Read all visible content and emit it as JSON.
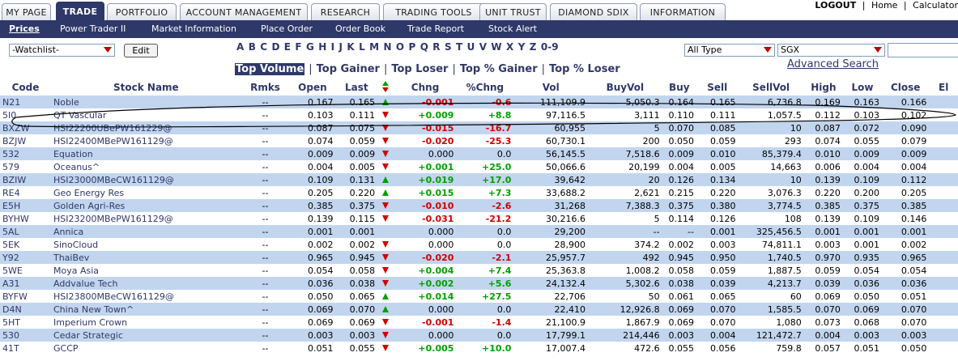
{
  "tabs": [
    {
      "label": "MY PAGE",
      "active": false
    },
    {
      "label": "TRADE",
      "active": true
    },
    {
      "label": "PORTFOLIO",
      "active": false
    },
    {
      "label": "ACCOUNT MANAGEMENT",
      "active": false
    },
    {
      "label": "RESEARCH",
      "active": false
    },
    {
      "label": "TRADING TOOLS",
      "active": false
    },
    {
      "label": "UNIT TRUST",
      "active": false
    },
    {
      "label": "DIAMOND SDIX",
      "active": false
    },
    {
      "label": "INFORMATION",
      "active": false
    }
  ],
  "top_links": {
    "logout": "LOGOUT",
    "home": "Home",
    "calculator": "Calculator",
    "sep": "|"
  },
  "subnav": [
    {
      "label": "Prices",
      "active": true
    },
    {
      "label": "Power Trader II",
      "active": false
    },
    {
      "label": "Market Information",
      "active": false
    },
    {
      "label": "Place Order",
      "active": false
    },
    {
      "label": "Order Book",
      "active": false
    },
    {
      "label": "Trade Report",
      "active": false
    },
    {
      "label": "Stock Alert",
      "active": false
    }
  ],
  "watchlist": {
    "value": "-Watchlist-"
  },
  "edit_label": "Edit",
  "alphabet": [
    "A",
    "B",
    "C",
    "D",
    "E",
    "F",
    "G",
    "H",
    "I",
    "J",
    "K",
    "L",
    "M",
    "N",
    "O",
    "P",
    "Q",
    "R",
    "S",
    "T",
    "U",
    "V",
    "W",
    "X",
    "Y",
    "Z",
    "0-9"
  ],
  "type_select": {
    "value": "All Type"
  },
  "exchange_select": {
    "value": "SGX"
  },
  "advanced_search": "Advanced Search",
  "filters": [
    {
      "label": "Top Volume",
      "active": true
    },
    {
      "label": "Top Gainer",
      "active": false
    },
    {
      "label": "Top Loser",
      "active": false
    },
    {
      "label": "Top % Gainer",
      "active": false
    },
    {
      "label": "Top % Loser",
      "active": false
    }
  ],
  "filter_sep": "|",
  "columns": [
    "Code",
    "Stock Name",
    "Rmks",
    "Open",
    "Last",
    "",
    "Chng",
    "%Chng",
    "Vol",
    "BuyVol",
    "Buy",
    "Sell",
    "SellVol",
    "High",
    "Low",
    "Close",
    "El"
  ],
  "colors": {
    "nav": "#2e3869",
    "row_alt": "#c2d5ee",
    "up": "#00a000",
    "down": "#d00000"
  },
  "rows": [
    {
      "code": "N21",
      "name": "Noble",
      "rmks": "--",
      "open": "0.167",
      "last": "0.165",
      "dir": "up",
      "chng": "-0.001",
      "pchng": "-0.6",
      "vol": "111,109.9",
      "buyvol": "5,050.3",
      "buy": "0.164",
      "sell": "0.165",
      "sellvol": "6,736.8",
      "high": "0.169",
      "low": "0.163",
      "close": "0.166"
    },
    {
      "code": "5I0",
      "name": "QT Vascular",
      "rmks": "--",
      "open": "0.103",
      "last": "0.111",
      "dir": "down",
      "chng": "+0.009",
      "pchng": "+8.8",
      "vol": "97,116.5",
      "buyvol": "3,111",
      "buy": "0.110",
      "sell": "0.111",
      "sellvol": "1,057.5",
      "high": "0.112",
      "low": "0.103",
      "close": "0.102"
    },
    {
      "code": "BXZW",
      "name": "HSI22200UBePW161229@",
      "rmks": "--",
      "open": "0.087",
      "last": "0.075",
      "dir": "down",
      "chng": "-0.015",
      "pchng": "-16.7",
      "vol": "60,955",
      "buyvol": "5",
      "buy": "0.070",
      "sell": "0.085",
      "sellvol": "10",
      "high": "0.087",
      "low": "0.072",
      "close": "0.090"
    },
    {
      "code": "BZJW",
      "name": "HSI22400MBePW161129@",
      "rmks": "--",
      "open": "0.074",
      "last": "0.059",
      "dir": "down",
      "chng": "-0.020",
      "pchng": "-25.3",
      "vol": "60,730.1",
      "buyvol": "200",
      "buy": "0.050",
      "sell": "0.059",
      "sellvol": "293",
      "high": "0.074",
      "low": "0.055",
      "close": "0.079"
    },
    {
      "code": "532",
      "name": "Equation",
      "rmks": "--",
      "open": "0.009",
      "last": "0.009",
      "dir": "down",
      "chng": "0.000",
      "pchng": "0.0",
      "vol": "56,145.5",
      "buyvol": "7,518.6",
      "buy": "0.009",
      "sell": "0.010",
      "sellvol": "85,379.4",
      "high": "0.010",
      "low": "0.009",
      "close": "0.009"
    },
    {
      "code": "579",
      "name": "Oceanus^",
      "rmks": "--",
      "open": "0.004",
      "last": "0.005",
      "dir": "down",
      "chng": "+0.001",
      "pchng": "+25.0",
      "vol": "50,066.6",
      "buyvol": "20,199",
      "buy": "0.004",
      "sell": "0.005",
      "sellvol": "14,663",
      "high": "0.006",
      "low": "0.004",
      "close": "0.004"
    },
    {
      "code": "BZIW",
      "name": "HSI23000MBeCW161129@",
      "rmks": "--",
      "open": "0.109",
      "last": "0.131",
      "dir": "up",
      "chng": "+0.019",
      "pchng": "+17.0",
      "vol": "39,642",
      "buyvol": "20",
      "buy": "0.126",
      "sell": "0.134",
      "sellvol": "10",
      "high": "0.139",
      "low": "0.109",
      "close": "0.112"
    },
    {
      "code": "RE4",
      "name": "Geo Energy Res",
      "rmks": "--",
      "open": "0.205",
      "last": "0.220",
      "dir": "up",
      "chng": "+0.015",
      "pchng": "+7.3",
      "vol": "33,688.2",
      "buyvol": "2,621",
      "buy": "0.215",
      "sell": "0.220",
      "sellvol": "3,076.3",
      "high": "0.220",
      "low": "0.200",
      "close": "0.205"
    },
    {
      "code": "E5H",
      "name": "Golden Agri-Res",
      "rmks": "--",
      "open": "0.385",
      "last": "0.375",
      "dir": "down",
      "chng": "-0.010",
      "pchng": "-2.6",
      "vol": "31,268",
      "buyvol": "7,388.3",
      "buy": "0.375",
      "sell": "0.380",
      "sellvol": "3,774.5",
      "high": "0.385",
      "low": "0.375",
      "close": "0.385"
    },
    {
      "code": "BYHW",
      "name": "HSI23200MBePW161129@",
      "rmks": "--",
      "open": "0.139",
      "last": "0.115",
      "dir": "down",
      "chng": "-0.031",
      "pchng": "-21.2",
      "vol": "30,216.6",
      "buyvol": "5",
      "buy": "0.114",
      "sell": "0.126",
      "sellvol": "108",
      "high": "0.139",
      "low": "0.109",
      "close": "0.146"
    },
    {
      "code": "5AL",
      "name": "Annica",
      "rmks": "--",
      "open": "0.001",
      "last": "0.001",
      "dir": "",
      "chng": "0.000",
      "pchng": "0.0",
      "vol": "29,200",
      "buyvol": "--",
      "buy": "--",
      "sell": "0.001",
      "sellvol": "325,456.5",
      "high": "0.001",
      "low": "0.001",
      "close": "0.001"
    },
    {
      "code": "5EK",
      "name": "SinoCloud",
      "rmks": "--",
      "open": "0.002",
      "last": "0.002",
      "dir": "down",
      "chng": "0.000",
      "pchng": "0.0",
      "vol": "28,900",
      "buyvol": "374.2",
      "buy": "0.002",
      "sell": "0.003",
      "sellvol": "74,811.1",
      "high": "0.003",
      "low": "0.001",
      "close": "0.002"
    },
    {
      "code": "Y92",
      "name": "ThaiBev",
      "rmks": "--",
      "open": "0.965",
      "last": "0.945",
      "dir": "down",
      "chng": "-0.020",
      "pchng": "-2.1",
      "vol": "25,957.7",
      "buyvol": "492",
      "buy": "0.945",
      "sell": "0.950",
      "sellvol": "1,740.5",
      "high": "0.970",
      "low": "0.935",
      "close": "0.965"
    },
    {
      "code": "5WE",
      "name": "Moya Asia",
      "rmks": "--",
      "open": "0.054",
      "last": "0.058",
      "dir": "down",
      "chng": "+0.004",
      "pchng": "+7.4",
      "vol": "25,363.8",
      "buyvol": "1,008.2",
      "buy": "0.058",
      "sell": "0.059",
      "sellvol": "1,887.5",
      "high": "0.059",
      "low": "0.054",
      "close": "0.054"
    },
    {
      "code": "A31",
      "name": "Addvalue Tech",
      "rmks": "--",
      "open": "0.036",
      "last": "0.038",
      "dir": "down",
      "chng": "+0.002",
      "pchng": "+5.6",
      "vol": "24,132.4",
      "buyvol": "5,302.6",
      "buy": "0.038",
      "sell": "0.039",
      "sellvol": "4,213.7",
      "high": "0.039",
      "low": "0.036",
      "close": "0.036"
    },
    {
      "code": "BYFW",
      "name": "HSI23800MBeCW161129@",
      "rmks": "--",
      "open": "0.050",
      "last": "0.065",
      "dir": "up",
      "chng": "+0.014",
      "pchng": "+27.5",
      "vol": "22,706",
      "buyvol": "50",
      "buy": "0.061",
      "sell": "0.065",
      "sellvol": "60",
      "high": "0.069",
      "low": "0.050",
      "close": "0.051"
    },
    {
      "code": "D4N",
      "name": "China New Town^",
      "rmks": "--",
      "open": "0.069",
      "last": "0.070",
      "dir": "up",
      "chng": "0.000",
      "pchng": "0.0",
      "vol": "22,410",
      "buyvol": "12,926.8",
      "buy": "0.069",
      "sell": "0.070",
      "sellvol": "1,585.5",
      "high": "0.070",
      "low": "0.069",
      "close": "0.070"
    },
    {
      "code": "5HT",
      "name": "Imperium Crown",
      "rmks": "--",
      "open": "0.069",
      "last": "0.069",
      "dir": "down",
      "chng": "-0.001",
      "pchng": "-1.4",
      "vol": "21,100.9",
      "buyvol": "1,867.9",
      "buy": "0.069",
      "sell": "0.070",
      "sellvol": "1,080",
      "high": "0.073",
      "low": "0.068",
      "close": "0.070"
    },
    {
      "code": "530",
      "name": "Cedar Strategic",
      "rmks": "--",
      "open": "0.003",
      "last": "0.003",
      "dir": "down",
      "chng": "0.000",
      "pchng": "0.0",
      "vol": "17,799.1",
      "buyvol": "214,446",
      "buy": "0.003",
      "sell": "0.004",
      "sellvol": "121,472.7",
      "high": "0.004",
      "low": "0.003",
      "close": "0.003"
    },
    {
      "code": "41T",
      "name": "GCCP",
      "rmks": "--",
      "open": "0.051",
      "last": "0.055",
      "dir": "down",
      "chng": "+0.005",
      "pchng": "+10.0",
      "vol": "17,007.4",
      "buyvol": "472.6",
      "buy": "0.055",
      "sell": "0.056",
      "sellvol": "759.8",
      "high": "0.057",
      "low": "0.051",
      "close": "0.050"
    }
  ]
}
